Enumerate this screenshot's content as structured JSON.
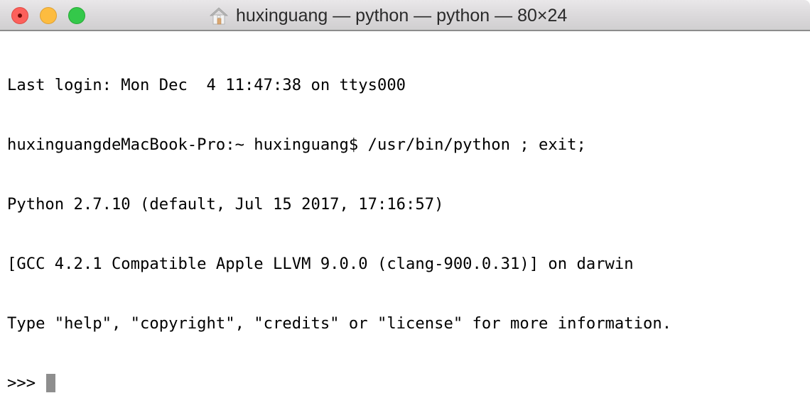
{
  "window": {
    "title": "huxinguang — python — python — 80×24",
    "title_icon": "home-icon",
    "controls": {
      "close": {
        "icon": "close-icon",
        "color": "#fc605b"
      },
      "minimize": {
        "icon": "minimize-icon",
        "color": "#fdbc40"
      },
      "zoom": {
        "icon": "zoom-icon",
        "color": "#34c84a"
      }
    }
  },
  "terminal": {
    "lines": [
      "Last login: Mon Dec  4 11:47:38 on ttys000",
      "huxinguangdeMacBook-Pro:~ huxinguang$ /usr/bin/python ; exit;",
      "Python 2.7.10 (default, Jul 15 2017, 17:16:57)",
      "[GCC 4.2.1 Compatible Apple LLVM 9.0.0 (clang-900.0.31)] on darwin",
      "Type \"help\", \"copyright\", \"credits\" or \"license\" for more information."
    ],
    "prompt": ">>> ",
    "input_value": "",
    "cursor_color": "#8e8e8e"
  }
}
